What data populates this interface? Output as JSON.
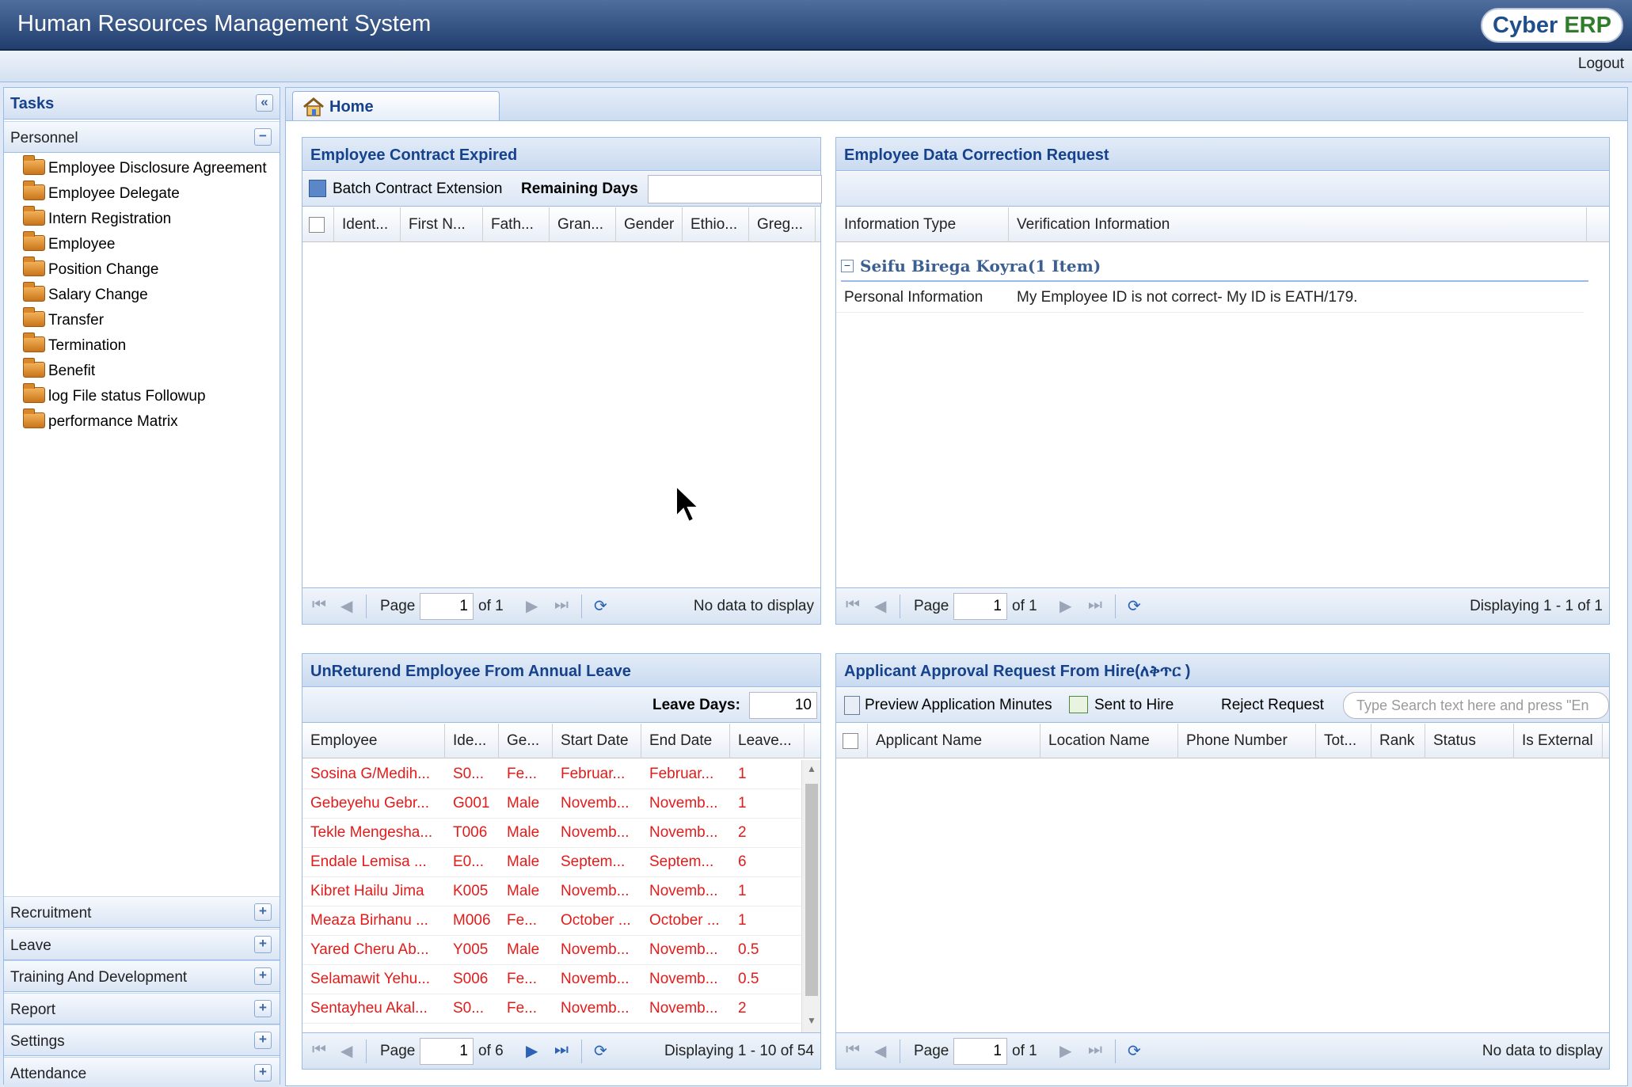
{
  "app": {
    "title": "Human Resources Management System",
    "logo_a": "Cyber",
    "logo_b": "ERP",
    "logout": "Logout"
  },
  "sidebar": {
    "title": "Tasks",
    "personnel": "Personnel",
    "items": [
      "Employee Disclosure Agreement",
      "Employee Delegate",
      "Intern Registration",
      "Employee",
      "Position Change",
      "Salary Change",
      "Transfer",
      "Termination",
      "Benefit",
      "log File status Followup",
      "performance Matrix"
    ],
    "sections": [
      "Recruitment",
      "Leave",
      "Training And Development",
      "Report",
      "Settings",
      "Attendance"
    ]
  },
  "tab": {
    "home": "Home"
  },
  "contract": {
    "title": "Employee Contract Expired",
    "batch": "Batch Contract Extension",
    "remaining": "Remaining Days",
    "remaining_value": "",
    "cols": [
      "Ident...",
      "First N...",
      "Fath...",
      "Gran...",
      "Gender",
      "Ethio...",
      "Greg..."
    ],
    "page_label": "Page",
    "page": "1",
    "of": "of 1",
    "status": "No data to display"
  },
  "correction": {
    "title": "Employee Data Correction Request",
    "cols": [
      "Information Type",
      "Verification Information"
    ],
    "group": "Seifu Birega Koyra(1 Item)",
    "row": [
      "Personal Information",
      "My Employee ID is not correct- My ID is EATH/179."
    ],
    "page_label": "Page",
    "page": "1",
    "of": "of 1",
    "status": "Displaying 1 - 1 of 1"
  },
  "leave": {
    "title": "UnReturend Employee From Annual Leave",
    "days_label": "Leave Days:",
    "days_value": "10",
    "cols": [
      "Employee",
      "Ide...",
      "Ge...",
      "Start Date",
      "End Date",
      "Leave..."
    ],
    "rows": [
      [
        "Sosina G/Medih...",
        "S0...",
        "Fe...",
        "Februar...",
        "Februar...",
        "1"
      ],
      [
        "Gebeyehu Gebr...",
        "G001",
        "Male",
        "Novemb...",
        "Novemb...",
        "1"
      ],
      [
        "Tekle Mengesha...",
        "T006",
        "Male",
        "Novemb...",
        "Novemb...",
        "2"
      ],
      [
        "Endale Lemisa ...",
        "E0...",
        "Male",
        "Septem...",
        "Septem...",
        "6"
      ],
      [
        "Kibret Hailu Jima",
        "K005",
        "Male",
        "Novemb...",
        "Novemb...",
        "1"
      ],
      [
        "Meaza Birhanu ...",
        "M006",
        "Fe...",
        "October ...",
        "October ...",
        "1"
      ],
      [
        "Yared Cheru Ab...",
        "Y005",
        "Male",
        "Novemb...",
        "Novemb...",
        "0.5"
      ],
      [
        "Selamawit Yehu...",
        "S006",
        "Fe...",
        "Novemb...",
        "Novemb...",
        "0.5"
      ],
      [
        "Sentayheu Akal...",
        "S0...",
        "Fe...",
        "Novemb...",
        "Novemb...",
        "2"
      ]
    ],
    "page_label": "Page",
    "page": "1",
    "of": "of 6",
    "status": "Displaying 1 - 10 of 54"
  },
  "applicant": {
    "title": "Applicant Approval Request From Hire(ለቅጥር )",
    "preview": "Preview Application Minutes",
    "sent": "Sent to Hire",
    "reject": "Reject Request",
    "search_placeholder": "Type Search text here and press \"En",
    "cols": [
      "Applicant Name",
      "Location Name",
      "Phone Number",
      "Tot...",
      "Rank",
      "Status",
      "Is External"
    ],
    "page_label": "Page",
    "page": "1",
    "of": "of 1",
    "status": "No data to display"
  }
}
